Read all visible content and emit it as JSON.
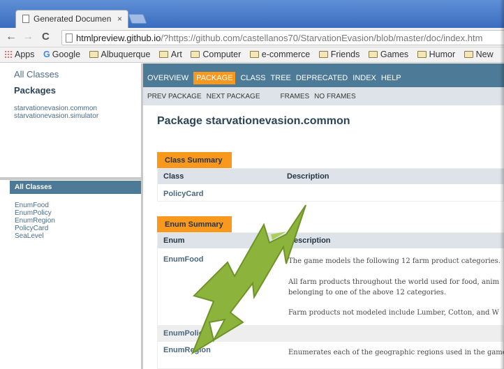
{
  "browser": {
    "tab_title": "Generated Documen",
    "tab_close": "×",
    "nav": {
      "back": "←",
      "forward": "→",
      "reload": "C"
    },
    "url_host": "htmlpreview.github.io",
    "url_rest": "/?https://github.com/castellanos70/StarvationEvasion/blob/master/doc/index.htm",
    "bookmarks": [
      "Apps",
      "Google",
      "Albuquerque",
      "Art",
      "Computer",
      "e-commerce",
      "Friends",
      "Games",
      "Humor",
      "New"
    ]
  },
  "left_frame": {
    "all_classes_link": "All Classes",
    "packages_title": "Packages",
    "packages": [
      "starvationevasion.common",
      "starvationevasion.simulator"
    ],
    "all_classes_header": "All Classes",
    "classes": [
      "EnumFood",
      "EnumPolicy",
      "EnumRegion",
      "PolicyCard",
      "SeaLevel"
    ]
  },
  "main_frame": {
    "top_nav": [
      "OVERVIEW",
      "PACKAGE",
      "CLASS",
      "TREE",
      "DEPRECATED",
      "INDEX",
      "HELP"
    ],
    "active_nav": "PACKAGE",
    "sub_nav": [
      "PREV PACKAGE",
      "NEXT PACKAGE",
      "FRAMES",
      "NO FRAMES"
    ],
    "title": "Package starvationevasion.common",
    "class_summary": {
      "caption": "Class Summary",
      "headers": [
        "Class",
        "Description"
      ],
      "rows": [
        {
          "name": "PolicyCard",
          "description": ""
        }
      ]
    },
    "enum_summary": {
      "caption": "Enum Summary",
      "headers": [
        "Enum",
        "Description"
      ],
      "enum_food": "EnumFood",
      "enum_food_desc": [
        "The game models the following 12 farm product categories.",
        "All farm products throughout the world used for food, anim",
        "belonging to one of the above 12 categories.",
        "Farm products not modeled include Lumber, Cotton, and W"
      ],
      "enum_policy": "EnumPolicy",
      "enum_region": "EnumRegion",
      "enum_region_desc": "Enumerates each of the geographic regions used in the game"
    }
  },
  "colors": {
    "nav_blue": "#4d7a97",
    "orange": "#f8981d",
    "arrow_green": "#8cb33c"
  }
}
